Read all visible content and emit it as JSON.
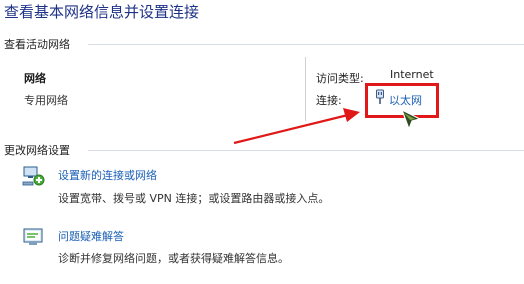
{
  "page_title": "查看基本网络信息并设置连接",
  "active_networks": {
    "section_label": "查看活动网络",
    "network_name": "网络",
    "network_type": "专用网络",
    "access_type_label": "访问类型:",
    "access_type_value": "Internet",
    "connections_label": "连接:",
    "connection_link": "以太网",
    "connection_icon": "ethernet-plug-icon"
  },
  "change_settings": {
    "section_label": "更改网络设置",
    "items": [
      {
        "icon": "network-setup-icon",
        "title": "设置新的连接或网络",
        "description": "设置宽带、拨号或 VPN 连接；或设置路由器或接入点。"
      },
      {
        "icon": "troubleshoot-icon",
        "title": "问题疑难解答",
        "description": "诊断并修复网络问题，或者获得疑难解答信息。"
      }
    ]
  },
  "annotation": {
    "highlight_color": "#e01818",
    "arrow_color": "#e01818"
  }
}
